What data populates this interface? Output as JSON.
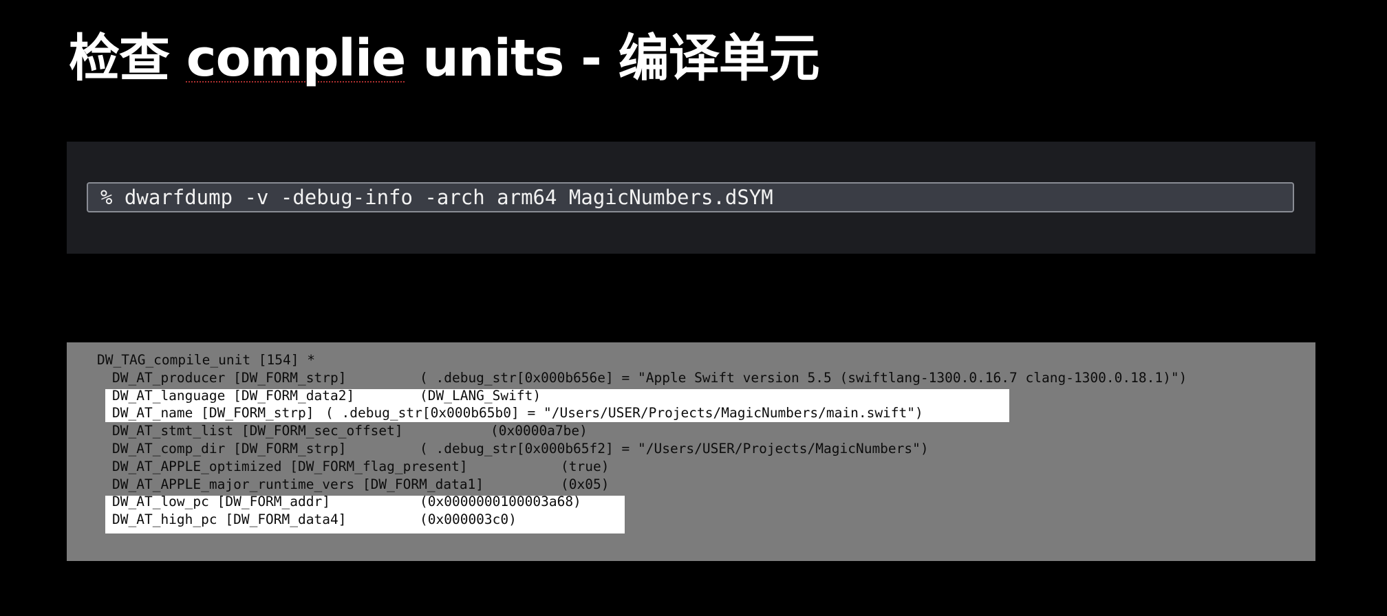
{
  "slide": {
    "title_prefix": "检查 ",
    "title_term": "complie",
    "title_suffix": " units - 编译单元"
  },
  "command": {
    "text": "% dwarfdump -v -debug-info -arch arm64 MagicNumbers.dSYM"
  },
  "output": {
    "header": "DW_TAG_compile_unit [154] *",
    "lines": [
      {
        "attr": "DW_AT_producer [DW_FORM_strp]",
        "value": "( .debug_str[0x000b656e] = \"Apple Swift version 5.5 (swiftlang-1300.0.16.7 clang-1300.0.18.1)\")",
        "highlighted": false
      },
      {
        "attr": "DW_AT_language [DW_FORM_data2]",
        "value": "(DW_LANG_Swift)",
        "highlighted": true
      },
      {
        "attr": "DW_AT_name [DW_FORM_strp]",
        "value": "( .debug_str[0x000b65b0] = \"/Users/USER/Projects/MagicNumbers/main.swift\")",
        "highlighted": true
      },
      {
        "attr": "DW_AT_stmt_list [DW_FORM_sec_offset]",
        "value": "(0x0000a7be)",
        "highlighted": false
      },
      {
        "attr": "DW_AT_comp_dir [DW_FORM_strp]",
        "value": "( .debug_str[0x000b65f2] = \"/Users/USER/Projects/MagicNumbers\")",
        "highlighted": false
      },
      {
        "attr": "DW_AT_APPLE_optimized [DW_FORM_flag_present]",
        "value": "(true)",
        "highlighted": false
      },
      {
        "attr": "DW_AT_APPLE_major_runtime_vers [DW_FORM_data1]",
        "value": "(0x05)",
        "highlighted": false
      },
      {
        "attr": "DW_AT_low_pc [DW_FORM_addr]",
        "value": "(0x0000000100003a68)",
        "highlighted": true
      },
      {
        "attr": "DW_AT_high_pc [DW_FORM_data4]",
        "value": "(0x000003c0)",
        "highlighted": true
      }
    ]
  }
}
